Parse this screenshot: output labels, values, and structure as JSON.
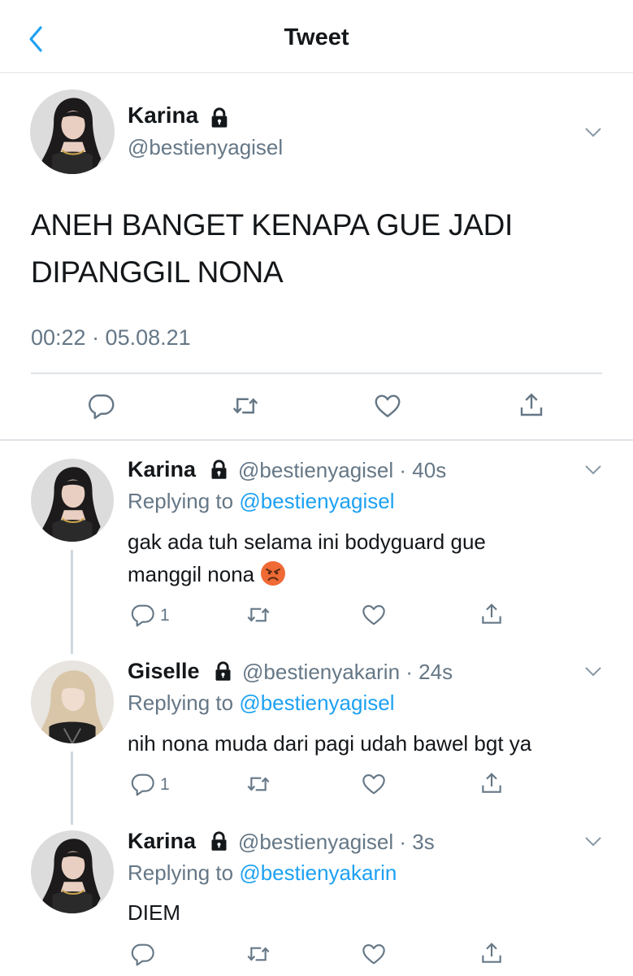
{
  "header": {
    "title": "Tweet"
  },
  "main_tweet": {
    "name": "Karina",
    "handle": "@bestienyagisel",
    "text_line1": "ANEH BANGET KENAPA GUE JADI",
    "text_line2": "DIPANGGIL NONA",
    "timestamp": "00:22 · 05.08.21"
  },
  "replies": [
    {
      "name": "Karina",
      "handle_time": "@bestienyagisel · 40s",
      "replying_prefix": "Replying to ",
      "replying_to": "@bestienyagisel",
      "text_line1": "gak ada tuh selama ini bodyguard gue",
      "text_line2": "manggil nona",
      "emoji": "angry-face",
      "reply_count": "1"
    },
    {
      "name": "Giselle",
      "handle_time": "@bestienyakarin · 24s",
      "replying_prefix": "Replying to ",
      "replying_to": "@bestienyagisel",
      "text_line1": "nih nona muda dari pagi udah bawel bgt ya",
      "reply_count": "1"
    },
    {
      "name": "Karina",
      "handle_time": "@bestienyagisel · 3s",
      "replying_prefix": "Replying to ",
      "replying_to": "@bestienyakarin",
      "text_line1": "DIEM"
    }
  ],
  "colors": {
    "accent": "#1da1f2",
    "secondary_text": "#657786",
    "divider": "#dfe3e7",
    "thread_line": "#cfd9de"
  }
}
